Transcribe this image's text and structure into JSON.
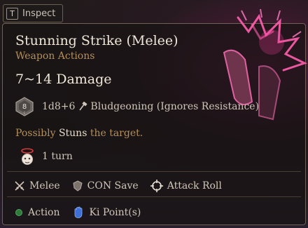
{
  "inspect": {
    "key": "T",
    "label": "Inspect"
  },
  "spell": {
    "title": "Stunning Strike (Melee)",
    "category": "Weapon Actions",
    "damage": "7~14 Damage",
    "die": {
      "value": "8",
      "sub": "C"
    },
    "damage_roll": "1d8+6",
    "damage_type": "Bludgeoning (Ignores Resistance)",
    "effect_prefix": "Possibly ",
    "effect_keyword": "Stuns",
    "effect_suffix": " the target.",
    "duration": "1 turn"
  },
  "properties": [
    {
      "icon": "crossed-swords-icon",
      "label": "Melee"
    },
    {
      "icon": "shield-icon",
      "label": "CON Save"
    },
    {
      "icon": "crosshair-icon",
      "label": "Attack Roll"
    }
  ],
  "costs": [
    {
      "icon": "action-dot-icon",
      "label": "Action",
      "color": "#2f7a3a"
    },
    {
      "icon": "ki-hand-icon",
      "label": "Ki Point(s)",
      "color": "#3d6fd6"
    }
  ],
  "colors": {
    "accent": "#b48f5c",
    "border": "#6e6254",
    "highlight": "#e0207c"
  }
}
